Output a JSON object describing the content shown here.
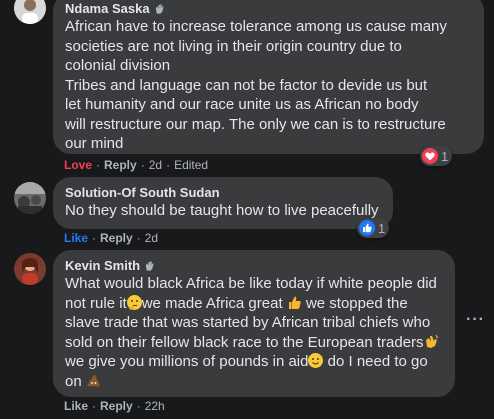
{
  "comments": [
    {
      "author": "Ndama Saska",
      "lines": [
        "African have to increase tolerance among us cause many",
        "societies are not living in their origin country due to",
        "colonial division",
        "Tribes and language can not be factor to devide us but",
        "let humanity and our race unite us as African no body",
        "will restructure our map. The only we can is to restructure",
        "our mind"
      ],
      "reaction_label": "Love",
      "reply_label": "Reply",
      "time": "2d",
      "edited": "Edited",
      "reaction_count": "1",
      "reaction_type": "love-icon"
    },
    {
      "author": "Solution-Of South Sudan",
      "lines": [
        "No they should be taught how to live peacefully"
      ],
      "reaction_label": "Like",
      "reply_label": "Reply",
      "time": "2d",
      "reaction_count": "1",
      "reaction_type": "like-icon"
    },
    {
      "author": "Kevin Smith",
      "line1": "What would black Africa be like today if white people did",
      "line2a": "not rule it",
      "line2b": "we made Africa great",
      "line2c": " we stopped the",
      "line3": "slave trade that was started by African tribal chiefs who",
      "line4": "sold on their fellow black race to the European traders",
      "line5a": "we give you millions of pounds in aid",
      "line5b": " do I need to go",
      "line6": "on",
      "reaction_label": "Like",
      "reply_label": "Reply",
      "time": "22h",
      "more": "···"
    }
  ],
  "colors": {
    "background": "#18191a",
    "bubble": "#3a3b3c",
    "love": "#f33e58",
    "like": "#2078f4",
    "secondary_text": "#b0b3b8"
  }
}
